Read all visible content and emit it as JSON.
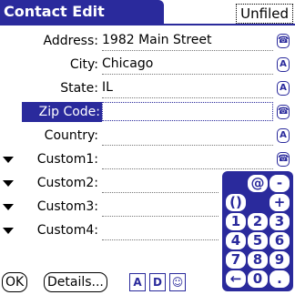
{
  "header": {
    "title": "Contact Edit",
    "category": "Unfiled"
  },
  "fields": [
    {
      "label": "Address:",
      "value": "1982 Main Street",
      "icon": "phone-book-icon"
    },
    {
      "label": "City:",
      "value": "Chicago",
      "icon": "text-icon"
    },
    {
      "label": "State:",
      "value": "IL",
      "icon": "text-icon"
    },
    {
      "label": "Zip Code:",
      "value": "",
      "icon": "phone-book-icon"
    },
    {
      "label": "Country:",
      "value": "",
      "icon": "text-icon"
    },
    {
      "label": "Custom1:",
      "value": "",
      "icon": "phone-book-icon"
    },
    {
      "label": "Custom2:",
      "value": ""
    },
    {
      "label": "Custom3:",
      "value": ""
    },
    {
      "label": "Custom4:",
      "value": ""
    }
  ],
  "keypad": {
    "keys": [
      "@",
      "-",
      "()",
      "+",
      "1",
      "2",
      "3",
      "4",
      "5",
      "6",
      "7",
      "8",
      "9",
      "←",
      "0",
      "."
    ]
  },
  "buttons": {
    "ok": "OK",
    "details": "Details...",
    "alpha_icon": "A",
    "note_icon": "D",
    "face_icon": "☺"
  },
  "colors": {
    "accent": "#2a2a9c"
  }
}
